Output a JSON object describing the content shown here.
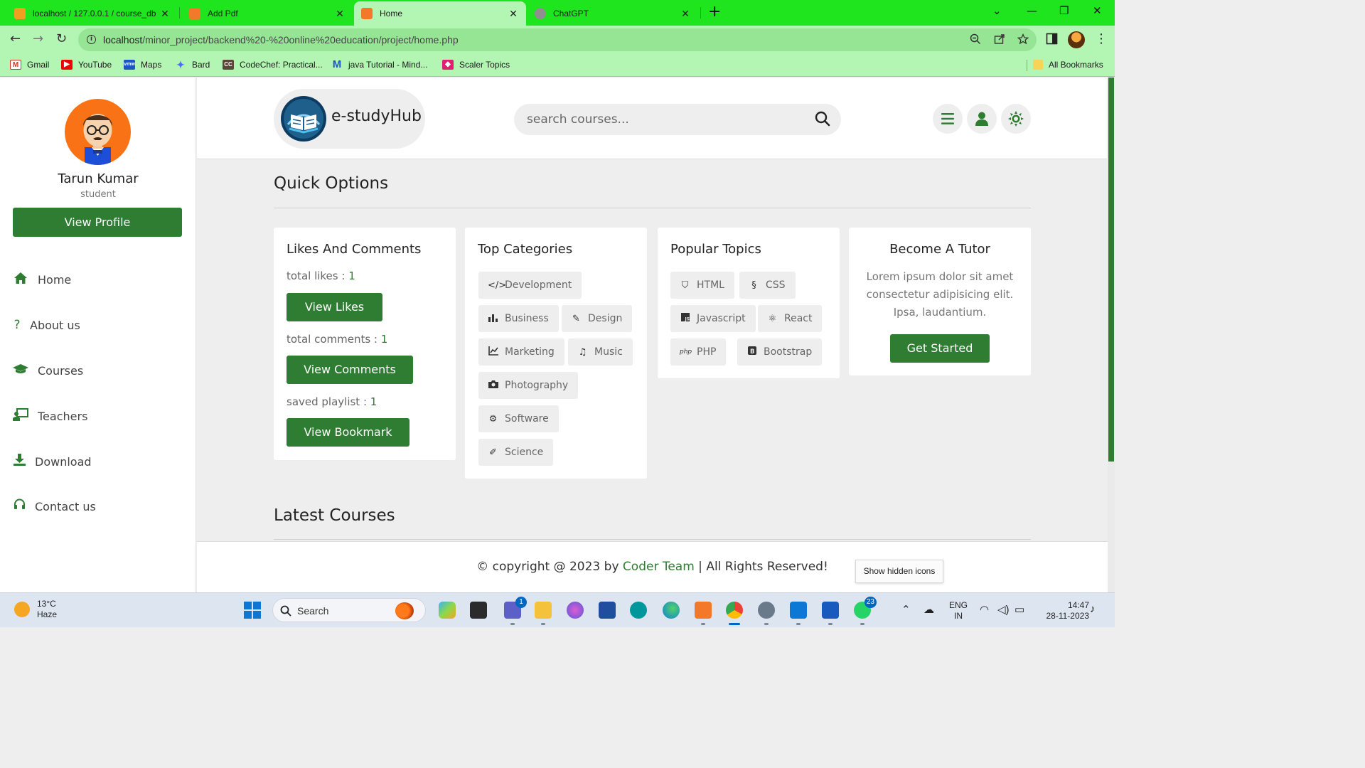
{
  "browser": {
    "tabs": [
      {
        "title": "localhost / 127.0.0.1 / course_db",
        "active": false
      },
      {
        "title": "Add Pdf",
        "active": false
      },
      {
        "title": "Home",
        "active": true
      },
      {
        "title": "ChatGPT",
        "active": false
      }
    ],
    "tab_close": "✕",
    "new_tab": "+",
    "url_host": "localhost",
    "url_path": "/minor_project/backend%20-%20online%20education/project/home.php",
    "bookmarks": [
      "Gmail",
      "YouTube",
      "Maps",
      "Bard",
      "CodeChef: Practical...",
      "java Tutorial - Mind...",
      "Scaler Topics"
    ],
    "all_bookmarks": "All Bookmarks",
    "accent": "#1ee51e"
  },
  "sidebar": {
    "user_name": "Tarun Kumar",
    "user_role": "student",
    "view_profile": "View Profile",
    "nav": [
      {
        "label": "Home",
        "icon": "home-icon"
      },
      {
        "label": "About us",
        "icon": "question-icon"
      },
      {
        "label": "Courses",
        "icon": "graduation-cap-icon"
      },
      {
        "label": "Teachers",
        "icon": "chalkboard-teacher-icon"
      },
      {
        "label": "Download",
        "icon": "download-icon"
      },
      {
        "label": "Contact us",
        "icon": "headset-icon"
      }
    ]
  },
  "header": {
    "logo_text": "e-studyHub",
    "search_placeholder": "search courses..."
  },
  "main": {
    "quick_options_title": "Quick Options",
    "latest_courses_title": "Latest Courses",
    "likes_card": {
      "title": "Likes And Comments",
      "likes_label": "total likes : ",
      "likes_value": "1",
      "view_likes": "View Likes",
      "comments_label": "total comments : ",
      "comments_value": "1",
      "view_comments": "View Comments",
      "playlist_label": "saved playlist : ",
      "playlist_value": "1",
      "view_bookmark": "View Bookmark"
    },
    "categories_card": {
      "title": "Top Categories",
      "items": [
        "Development",
        "Business",
        "Design",
        "Marketing",
        "Music",
        "Photography",
        "Software",
        "Science"
      ]
    },
    "topics_card": {
      "title": "Popular Topics",
      "items": [
        "HTML",
        "CSS",
        "Javascript",
        "React",
        "PHP",
        "Bootstrap"
      ]
    },
    "tutor_card": {
      "title": "Become A Tutor",
      "text": "Lorem ipsum dolor sit amet consectetur adipisicing elit. Ipsa, laudantium.",
      "button": "Get Started"
    },
    "accent": "#2e7d32"
  },
  "footer": {
    "prefix": "© copyright @ 2023 by ",
    "team": "Coder Team",
    "suffix": " | All Rights Reserved!"
  },
  "tooltip": "Show hidden icons",
  "taskbar": {
    "temp": "13°C",
    "condition": "Haze",
    "search": "Search",
    "teams_badge": "1",
    "whatsapp_badge": "23",
    "lang_1": "ENG",
    "lang_2": "IN",
    "time": "14:47",
    "date": "28-11-2023"
  }
}
